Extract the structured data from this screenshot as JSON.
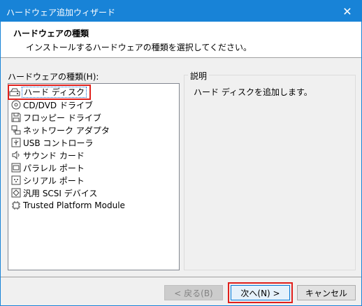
{
  "window": {
    "title": "ハードウェア追加ウィザード",
    "close_glyph": "✕"
  },
  "header": {
    "title": "ハードウェアの種類",
    "subtitle": "インストールするハードウェアの種類を選択してください。"
  },
  "hardware_list": {
    "label": "ハードウェアの種類(H):",
    "selected_index": 0,
    "items": [
      {
        "label": "ハード ディスク",
        "icon": "hard-disk-icon"
      },
      {
        "label": "CD/DVD ドライブ",
        "icon": "cd-dvd-icon"
      },
      {
        "label": "フロッピー ドライブ",
        "icon": "floppy-icon"
      },
      {
        "label": "ネットワーク アダプタ",
        "icon": "network-adapter-icon"
      },
      {
        "label": "USB コントローラ",
        "icon": "usb-icon"
      },
      {
        "label": "サウンド カード",
        "icon": "speaker-icon"
      },
      {
        "label": "パラレル ポート",
        "icon": "parallel-port-icon"
      },
      {
        "label": "シリアル ポート",
        "icon": "serial-port-icon"
      },
      {
        "label": "汎用 SCSI デバイス",
        "icon": "scsi-icon"
      },
      {
        "label": "Trusted Platform Module",
        "icon": "tpm-icon"
      }
    ]
  },
  "description": {
    "legend": "説明",
    "text": "ハード ディスクを追加します。"
  },
  "buttons": {
    "back": "< 戻る(B)",
    "next": "次へ(N) >",
    "cancel": "キャンセル"
  },
  "colors": {
    "titlebar": "#1883d7",
    "highlight": "#e0201c"
  }
}
